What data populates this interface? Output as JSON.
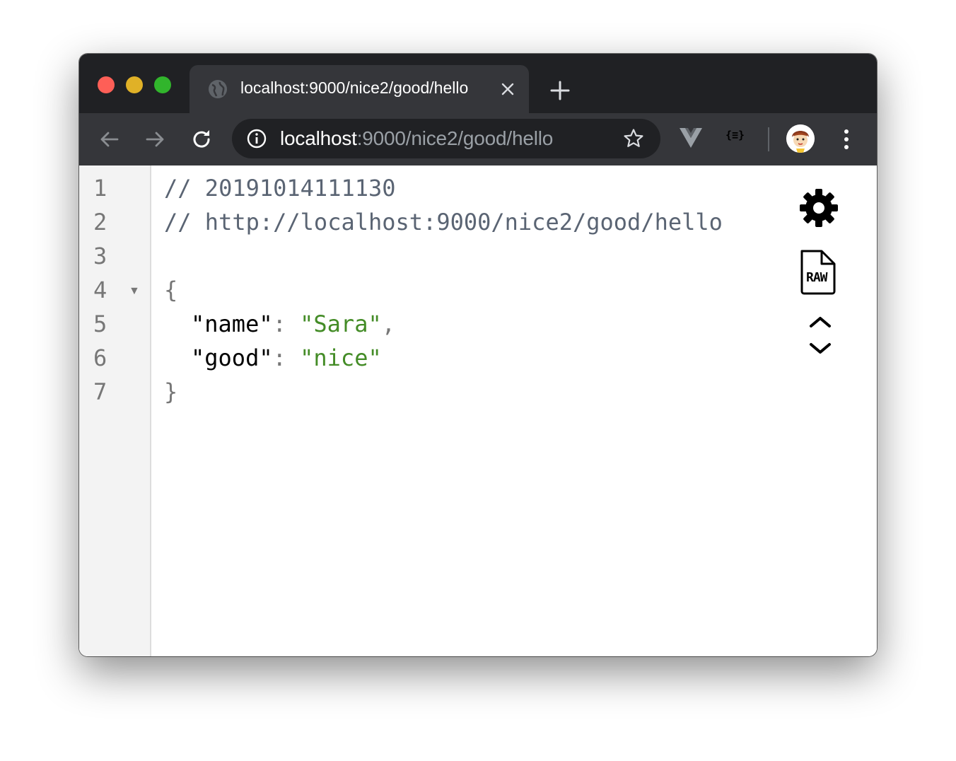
{
  "window": {
    "traffic_lights": [
      "close",
      "minimize",
      "zoom"
    ]
  },
  "tab": {
    "title": "localhost:9000/nice2/good/hello",
    "favicon": "globe-icon",
    "close_icon": "close-icon"
  },
  "new_tab_icon": "plus-icon",
  "toolbar": {
    "back_icon": "back-arrow-icon",
    "forward_icon": "forward-arrow-icon",
    "reload_icon": "reload-icon",
    "url_host": "localhost",
    "url_rest": ":9000/nice2/good/hello",
    "site_info_icon": "info-icon",
    "bookmark_icon": "star-icon",
    "extensions": [
      "vue-devtools-icon",
      "json-viewer-icon"
    ],
    "json_ext_label": "{≡}",
    "profile_icon": "avatar",
    "menu_icon": "kebab-menu-icon"
  },
  "editor": {
    "line_numbers": [
      "1",
      "2",
      "3",
      "4",
      "5",
      "6",
      "7"
    ],
    "comment1": "// 20191014111130",
    "comment2": "// http://localhost:9000/nice2/good/hello",
    "open_brace": "{",
    "close_brace": "}",
    "entries": [
      {
        "key": "\"name\"",
        "colon": ":",
        "value": "\"Sara\"",
        "comma": ","
      },
      {
        "key": "\"good\"",
        "colon": ":",
        "value": "\"nice\"",
        "comma": ""
      }
    ],
    "fold_marker": "▼"
  },
  "side_actions": {
    "settings_icon": "gear-icon",
    "raw_icon": "raw-file-icon",
    "raw_label": "RAW",
    "toggle_icon": "collapse-expand-icon"
  },
  "colors": {
    "titlebar": "#202124",
    "toolbar": "#35363a",
    "string": "#448c27",
    "comment": "#5a6473"
  }
}
